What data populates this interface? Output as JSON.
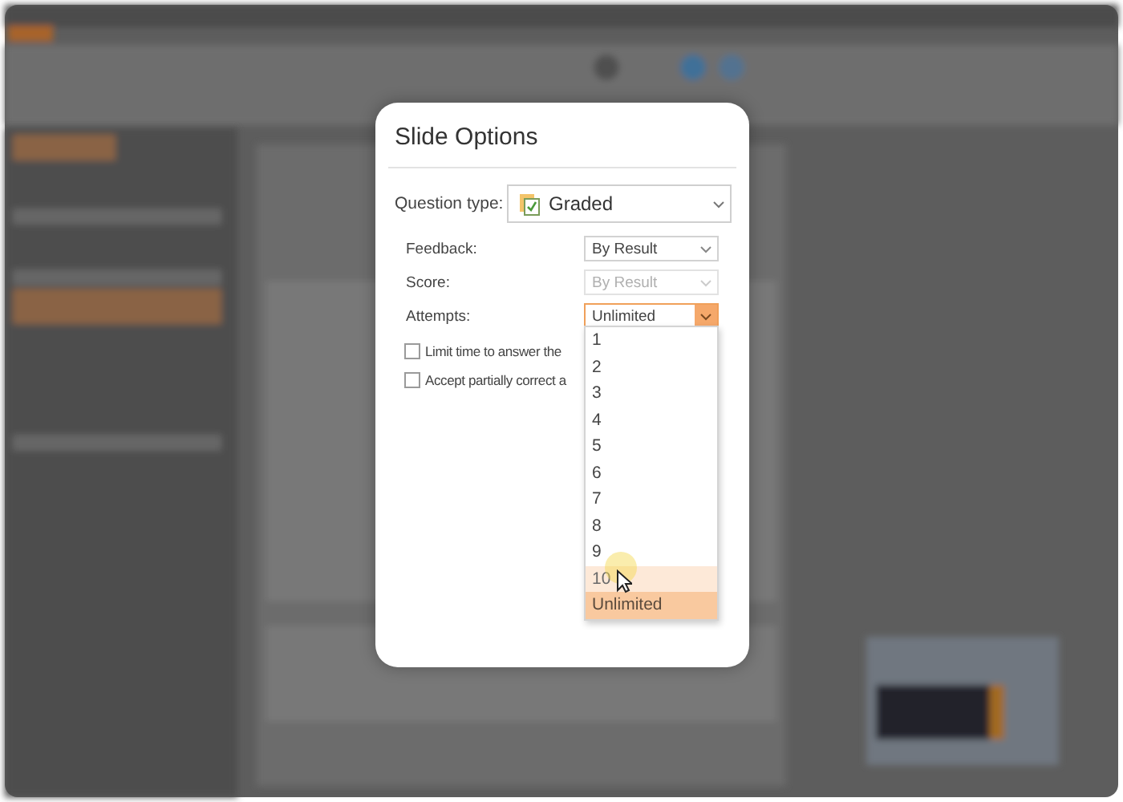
{
  "dialog": {
    "title": "Slide Options",
    "question_type": {
      "label": "Question type:",
      "value": "Graded"
    },
    "fields": [
      {
        "label": "Feedback:",
        "value": "By Result",
        "disabled": false,
        "focused": false
      },
      {
        "label": "Score:",
        "value": "By Result",
        "disabled": true,
        "focused": false
      },
      {
        "label": "Attempts:",
        "value": "Unlimited",
        "disabled": false,
        "focused": true
      }
    ],
    "checkboxes": [
      {
        "label": "Limit time to answer the",
        "checked": false
      },
      {
        "label": "Accept partially correct a",
        "checked": false
      }
    ],
    "attempts_list": [
      {
        "label": "1",
        "selected": false,
        "hovered": false
      },
      {
        "label": "2",
        "selected": false,
        "hovered": false
      },
      {
        "label": "3",
        "selected": false,
        "hovered": false
      },
      {
        "label": "4",
        "selected": false,
        "hovered": false
      },
      {
        "label": "5",
        "selected": false,
        "hovered": false
      },
      {
        "label": "6",
        "selected": false,
        "hovered": false
      },
      {
        "label": "7",
        "selected": false,
        "hovered": false
      },
      {
        "label": "8",
        "selected": false,
        "hovered": false
      },
      {
        "label": "9",
        "selected": false,
        "hovered": false
      },
      {
        "label": "10",
        "selected": false,
        "hovered": true
      },
      {
        "label": "Unlimited",
        "selected": true,
        "hovered": false
      }
    ]
  }
}
